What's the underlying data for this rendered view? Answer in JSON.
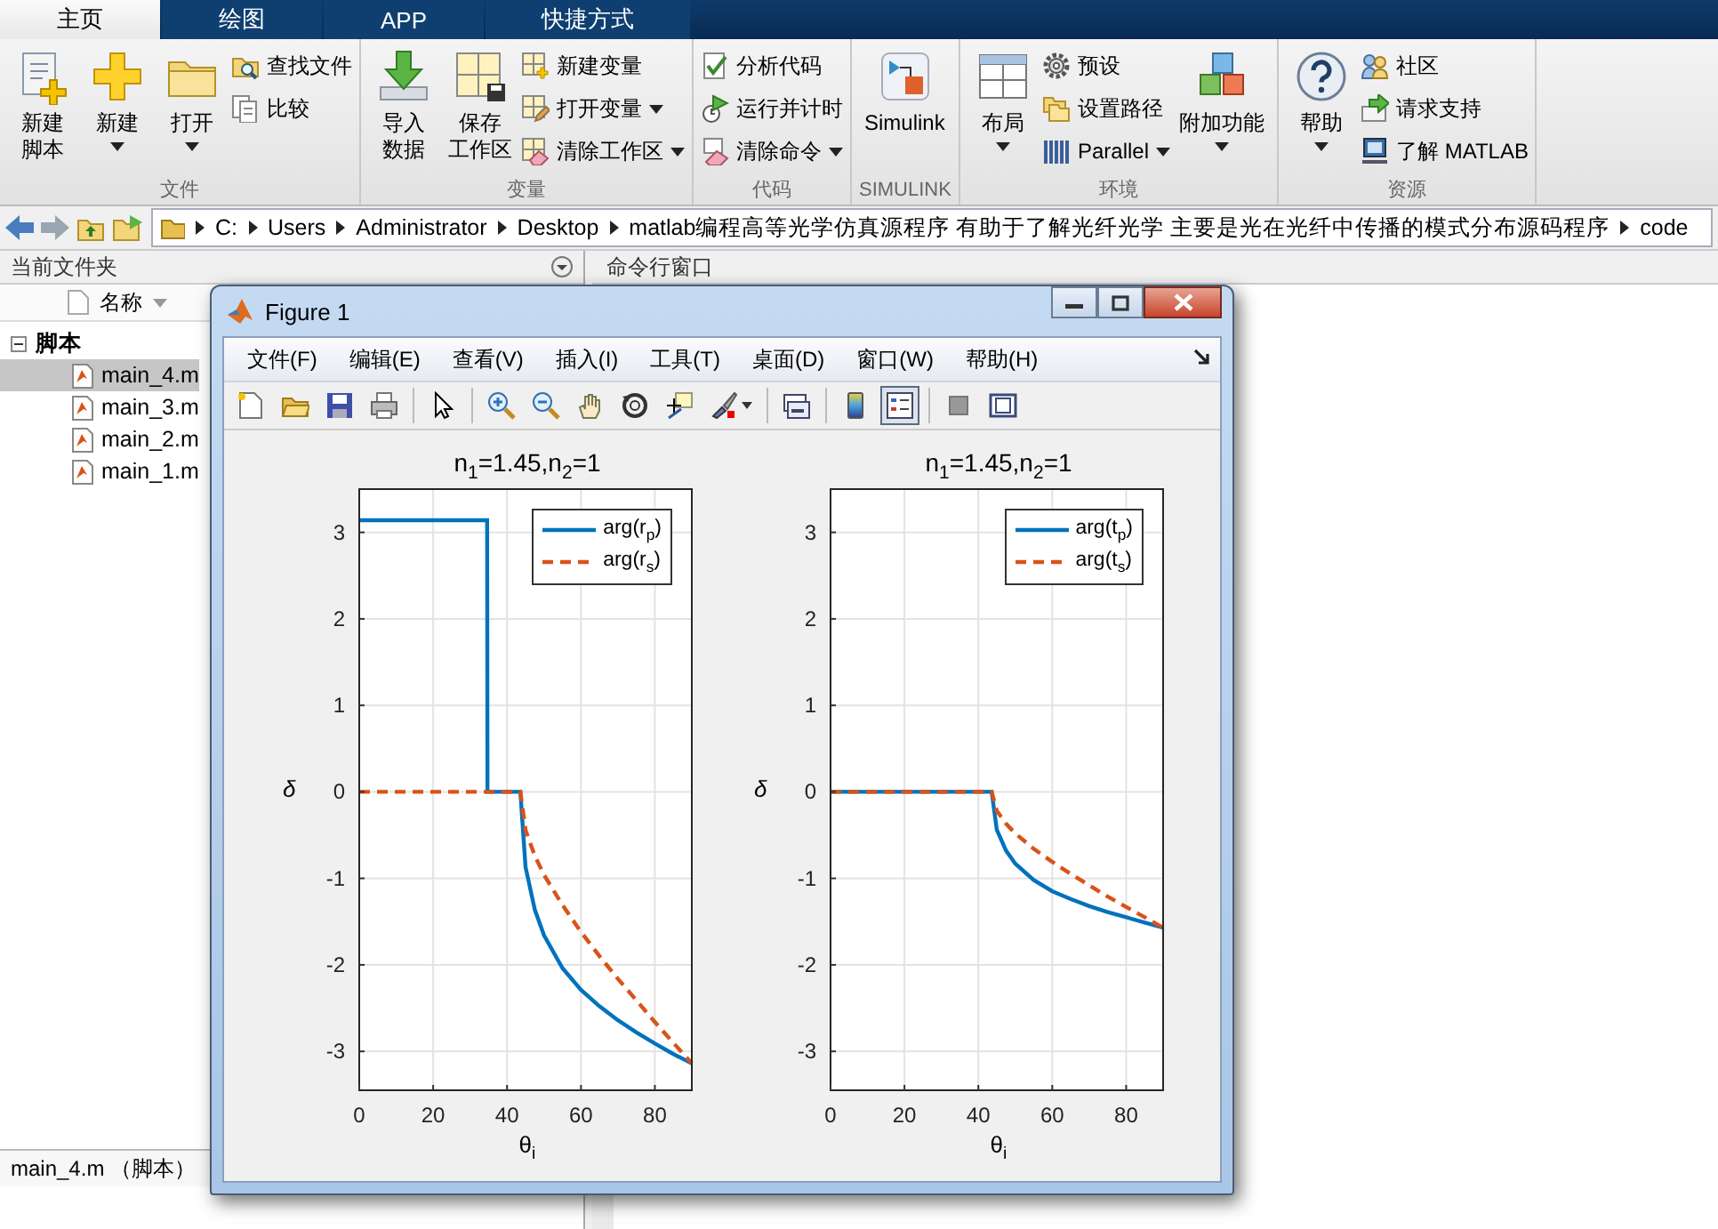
{
  "ribbon": {
    "tabs": [
      {
        "label": "主页",
        "selected": true
      },
      {
        "label": "绘图",
        "selected": false
      },
      {
        "label": "APP",
        "selected": false
      },
      {
        "label": "快捷方式",
        "selected": false
      }
    ],
    "groups": [
      {
        "title": "文件",
        "items": [
          {
            "kind": "large",
            "lines": [
              "新建",
              "脚本"
            ],
            "dropdown": false
          },
          {
            "kind": "large",
            "lines": [
              "新建"
            ],
            "dropdown": true
          },
          {
            "kind": "large",
            "lines": [
              "打开"
            ],
            "dropdown": true
          },
          {
            "kind": "stack",
            "items": [
              {
                "label": "查找文件",
                "dropdown": false
              },
              {
                "label": "比较",
                "dropdown": false
              }
            ]
          }
        ]
      },
      {
        "title": "变量",
        "items": [
          {
            "kind": "large",
            "lines": [
              "导入",
              "数据"
            ],
            "dropdown": false
          },
          {
            "kind": "large",
            "lines": [
              "保存",
              "工作区"
            ],
            "dropdown": false
          },
          {
            "kind": "stack",
            "items": [
              {
                "label": "新建变量",
                "dropdown": false
              },
              {
                "label": "打开变量",
                "dropdown": true
              },
              {
                "label": "清除工作区",
                "dropdown": true
              }
            ]
          }
        ]
      },
      {
        "title": "代码",
        "items": [
          {
            "kind": "stack",
            "items": [
              {
                "label": "分析代码",
                "dropdown": false
              },
              {
                "label": "运行并计时",
                "dropdown": false
              },
              {
                "label": "清除命令",
                "dropdown": true
              }
            ]
          }
        ]
      },
      {
        "title": "SIMULINK",
        "items": [
          {
            "kind": "large",
            "lines": [
              "Simulink"
            ],
            "dropdown": false
          }
        ]
      },
      {
        "title": "环境",
        "items": [
          {
            "kind": "large",
            "lines": [
              "布局"
            ],
            "dropdown": true
          },
          {
            "kind": "stack",
            "items": [
              {
                "label": "预设",
                "dropdown": false
              },
              {
                "label": "设置路径",
                "dropdown": false
              },
              {
                "label": "Parallel",
                "dropdown": true
              }
            ]
          },
          {
            "kind": "large",
            "lines": [
              "附加功能"
            ],
            "dropdown": true
          }
        ]
      },
      {
        "title": "资源",
        "items": [
          {
            "kind": "large",
            "lines": [
              "帮助"
            ],
            "dropdown": true
          },
          {
            "kind": "stack",
            "items": [
              {
                "label": "社区",
                "dropdown": false
              },
              {
                "label": "请求支持",
                "dropdown": false
              },
              {
                "label": "了解 MATLAB",
                "dropdown": false
              }
            ]
          }
        ]
      }
    ]
  },
  "address_bar": {
    "path": [
      "C:",
      "Users",
      "Administrator",
      "Desktop",
      "matlab编程高等光学仿真源程序 有助于了解光纤光学 主要是光在光纤中传播的模式分布源码程序",
      "code"
    ]
  },
  "current_folder": {
    "title": "当前文件夹",
    "column": "名称",
    "tree": [
      {
        "label": "脚本",
        "expanded": true,
        "children": [
          {
            "label": "main_4.m",
            "selected": true
          },
          {
            "label": "main_3.m",
            "selected": false
          },
          {
            "label": "main_2.m",
            "selected": false
          },
          {
            "label": "main_1.m",
            "selected": false
          }
        ]
      }
    ],
    "status": "main_4.m （脚本）"
  },
  "command_window": {
    "title": "命令行窗口"
  },
  "figure": {
    "title": "Figure 1",
    "menu": [
      "文件(F)",
      "编辑(E)",
      "查看(V)",
      "插入(I)",
      "工具(T)",
      "桌面(D)",
      "窗口(W)",
      "帮助(H)"
    ],
    "toolbar": [
      {
        "kind": "button",
        "pressed": false
      },
      {
        "kind": "button",
        "pressed": false
      },
      {
        "kind": "button",
        "pressed": false
      },
      {
        "kind": "button",
        "pressed": false
      },
      {
        "kind": "separator"
      },
      {
        "kind": "button",
        "pressed": false
      },
      {
        "kind": "separator"
      },
      {
        "kind": "button",
        "pressed": false
      },
      {
        "kind": "button",
        "pressed": false
      },
      {
        "kind": "button",
        "pressed": false
      },
      {
        "kind": "button",
        "pressed": false
      },
      {
        "kind": "button",
        "pressed": false
      },
      {
        "kind": "button",
        "pressed": false
      },
      {
        "kind": "separator"
      },
      {
        "kind": "button",
        "pressed": false
      },
      {
        "kind": "separator"
      },
      {
        "kind": "button",
        "pressed": false
      },
      {
        "kind": "button",
        "pressed": true
      },
      {
        "kind": "separator"
      },
      {
        "kind": "button",
        "pressed": false
      },
      {
        "kind": "button",
        "pressed": false
      }
    ],
    "axes": [
      {
        "chart_data": {
          "type": "line",
          "title": "n$_{1}$=1.45,n$_{2}$=1",
          "xlabel": "θ$_{i}$",
          "ylabel": "δ",
          "x": [
            0,
            10,
            20,
            30,
            34.6,
            34.7,
            40,
            43.6,
            45,
            47.5,
            50,
            55,
            60,
            65,
            70,
            75,
            80,
            85,
            90
          ],
          "xlim": [
            0,
            90
          ],
          "ylim": [
            -3.45,
            3.5
          ],
          "xticks": [
            0,
            20,
            40,
            60,
            80
          ],
          "yticks": [
            -3,
            -2,
            -1,
            0,
            1,
            2,
            3
          ],
          "grid": true,
          "legend": true,
          "series": [
            {
              "name": "arg(r$_{p}$)",
              "color": "#0072bd",
              "line_style": "solid",
              "values": [
                3.14,
                3.14,
                3.14,
                3.14,
                3.14,
                0,
                0,
                0,
                -0.87,
                -1.36,
                -1.66,
                -2.04,
                -2.29,
                -2.48,
                -2.64,
                -2.78,
                -2.91,
                -3.03,
                -3.14
              ]
            },
            {
              "name": "arg(r$_{s}$)",
              "color": "#d95319",
              "line_style": "dashed",
              "values": [
                0,
                0,
                0,
                0,
                0,
                0,
                0,
                0,
                -0.44,
                -0.74,
                -0.96,
                -1.31,
                -1.62,
                -1.9,
                -2.16,
                -2.41,
                -2.66,
                -2.9,
                -3.14
              ]
            }
          ]
        }
      },
      {
        "chart_data": {
          "type": "line",
          "title": "n$_{1}$=1.45,n$_{2}$=1",
          "xlabel": "θ$_{i}$",
          "ylabel": "δ",
          "x": [
            0,
            10,
            20,
            30,
            34.6,
            34.7,
            40,
            43.6,
            45,
            47.5,
            50,
            55,
            60,
            65,
            70,
            75,
            80,
            85,
            90
          ],
          "xlim": [
            0,
            90
          ],
          "ylim": [
            -3.45,
            3.5
          ],
          "xticks": [
            0,
            20,
            40,
            60,
            80
          ],
          "yticks": [
            -3,
            -2,
            -1,
            0,
            1,
            2,
            3
          ],
          "grid": true,
          "legend": true,
          "series": [
            {
              "name": "arg(t$_{p}$)",
              "color": "#0072bd",
              "line_style": "solid",
              "values": [
                0,
                0,
                0,
                0,
                0,
                0,
                0,
                0,
                -0.44,
                -0.68,
                -0.83,
                -1.02,
                -1.15,
                -1.24,
                -1.32,
                -1.39,
                -1.45,
                -1.51,
                -1.57
              ]
            },
            {
              "name": "arg(t$_{s}$)",
              "color": "#d95319",
              "line_style": "dashed",
              "values": [
                0,
                0,
                0,
                0,
                0,
                0,
                0,
                0,
                -0.22,
                -0.37,
                -0.48,
                -0.66,
                -0.81,
                -0.95,
                -1.08,
                -1.21,
                -1.33,
                -1.45,
                -1.57
              ]
            }
          ]
        }
      }
    ]
  }
}
